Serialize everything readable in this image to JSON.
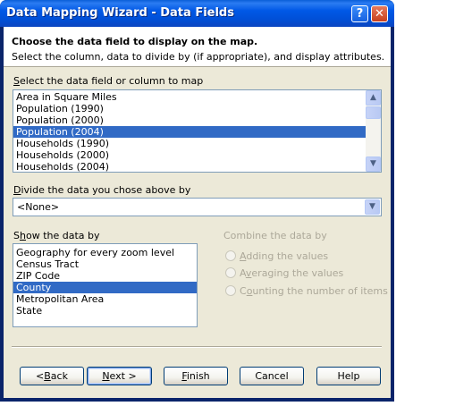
{
  "window": {
    "title": "Data Mapping Wizard - Data Fields",
    "help_glyph": "?",
    "close_glyph": "✕"
  },
  "header": {
    "title": "Choose the data field to display on the map.",
    "subtitle": "Select the column, data to divide by (if appropriate), and display attributes."
  },
  "field_list": {
    "label_underlined": "S",
    "label_rest": "elect the data field or column to map",
    "items": [
      {
        "label": "Area in Square Miles",
        "selected": false
      },
      {
        "label": "Population (1990)",
        "selected": false
      },
      {
        "label": "Population (2000)",
        "selected": false
      },
      {
        "label": "Population (2004)",
        "selected": true
      },
      {
        "label": "Households (1990)",
        "selected": false
      },
      {
        "label": "Households (2000)",
        "selected": false
      },
      {
        "label": "Households (2004)",
        "selected": false
      }
    ]
  },
  "divide_by": {
    "label_underlined": "D",
    "label_rest": "ivide the data you chose above by",
    "value": "<None>"
  },
  "show_by": {
    "label_pre": "S",
    "label_underlined": "h",
    "label_rest": "ow the data by",
    "items": [
      {
        "label": "Geography for every zoom level",
        "selected": false
      },
      {
        "label": "Census Tract",
        "selected": false
      },
      {
        "label": "ZIP Code",
        "selected": false
      },
      {
        "label": "County",
        "selected": true
      },
      {
        "label": "Metropolitan Area",
        "selected": false
      },
      {
        "label": "State",
        "selected": false
      }
    ]
  },
  "combine": {
    "label": "Combine the data by",
    "options": [
      {
        "underlined": "A",
        "rest": "dding the values"
      },
      {
        "underlined": "v",
        "pre": "A",
        "rest": "eraging the values"
      },
      {
        "underlined": "o",
        "pre": "C",
        "rest": "unting the number of items"
      }
    ]
  },
  "buttons": {
    "back": {
      "pre": "<",
      "underlined": "B",
      "rest": "ack"
    },
    "next": {
      "pre": "",
      "underlined": "N",
      "rest": "ext >"
    },
    "finish": {
      "pre": "",
      "underlined": "F",
      "rest": "inish"
    },
    "cancel": "Cancel",
    "help": "Help"
  }
}
